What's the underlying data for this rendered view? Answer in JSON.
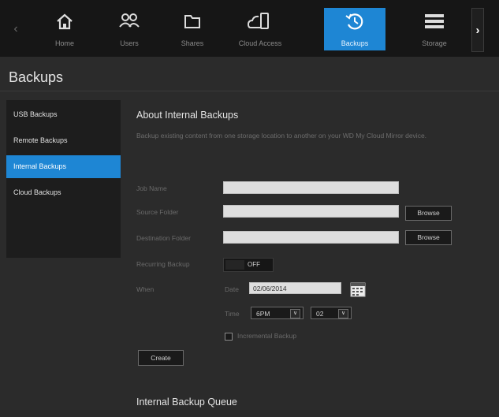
{
  "nav": {
    "items": [
      {
        "label": "Home",
        "icon": "home-icon"
      },
      {
        "label": "Users",
        "icon": "users-icon"
      },
      {
        "label": "Shares",
        "icon": "folder-icon"
      },
      {
        "label": "Cloud Access",
        "icon": "cloud-device-icon"
      },
      {
        "label": "Backups",
        "icon": "history-icon",
        "active": true
      },
      {
        "label": "Storage",
        "icon": "storage-icon"
      }
    ],
    "accent": "#1e86d4"
  },
  "page": {
    "title": "Backups"
  },
  "sidebar": {
    "items": [
      {
        "label": "USB Backups"
      },
      {
        "label": "Remote Backups"
      },
      {
        "label": "Internal Backups",
        "active": true
      },
      {
        "label": "Cloud Backups"
      }
    ]
  },
  "main": {
    "heading": "About Internal Backups",
    "description": "Backup existing content from one storage location to another on your WD My Cloud Mirror device.",
    "job_name_label": "Job Name",
    "job_name_value": "",
    "source_label": "Source Folder",
    "source_value": "",
    "destination_label": "Destination Folder",
    "destination_value": "",
    "browse_label": "Browse",
    "recurring_label": "Recurring Backup",
    "recurring_state": "OFF",
    "when_label": "When",
    "date_label": "Date",
    "date_value": "02/06/2014",
    "time_label": "Time",
    "hour_value": "6PM",
    "minute_value": "02",
    "incremental_label": "Incremental Backup",
    "incremental_checked": false,
    "create_label": "Create",
    "queue_heading": "Internal Backup Queue"
  }
}
